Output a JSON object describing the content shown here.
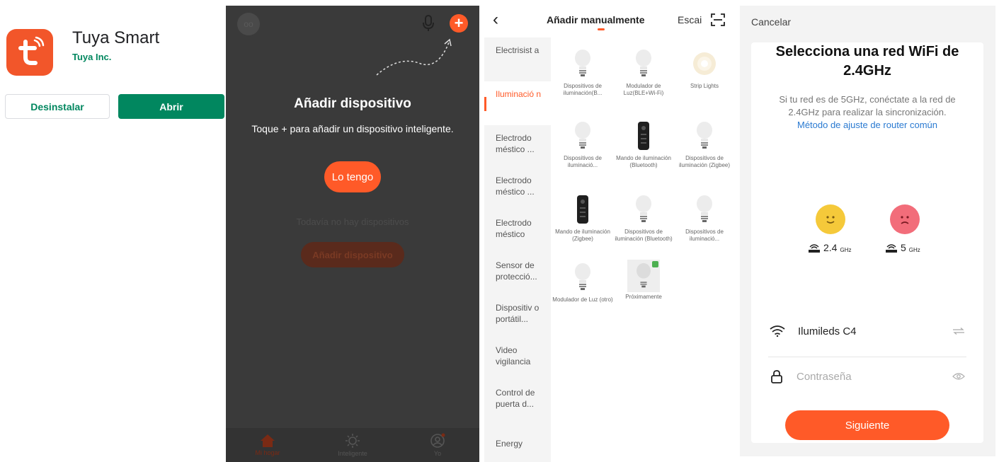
{
  "store": {
    "app_name": "Tuya Smart",
    "developer": "Tuya Inc.",
    "uninstall_label": "Desinstalar",
    "open_label": "Abrir",
    "icon_color": "#f2562a",
    "accent": "#01875f"
  },
  "home": {
    "overlay_title": "Añadir dispositivo",
    "overlay_hint": "Toque + para añadir un dispositivo inteligente.",
    "got_it_label": "Lo tengo",
    "empty_text": "Todavía no hay dispositivos",
    "add_device_label": "Añadir dispositivo",
    "tabs": [
      {
        "label": "Mi hogar",
        "icon": "home-icon"
      },
      {
        "label": "Inteligente",
        "icon": "sun-icon"
      },
      {
        "label": "Yo",
        "icon": "profile-icon"
      }
    ],
    "accent": "#ff5a28"
  },
  "manual": {
    "title": "Añadir manualmente",
    "scan_label": "Escai",
    "categories": [
      "Electrisist a",
      "Iluminació n",
      "Electrodo méstico ...",
      "Electrodo méstico ...",
      "Electrodo méstico",
      "Sensor de protecció...",
      "Dispositiv o portátil...",
      "Video vigilancia",
      "Control de puerta d...",
      "Energy"
    ],
    "active_category": 1,
    "devices": [
      {
        "name": "Dispositivos de iluminación(B...",
        "icon": "bulb-icon"
      },
      {
        "name": "Modulador de Luz(BLE+Wi-Fi)",
        "icon": "bulb-icon"
      },
      {
        "name": "Strip Lights",
        "icon": "strip-light-icon"
      },
      {
        "name": "Dispositivos de iluminació...",
        "icon": "bulb-icon"
      },
      {
        "name": "Mando de iluminación (Bluetooth)",
        "icon": "remote-icon"
      },
      {
        "name": "Dispositivos de iluminación (Zigbee)",
        "icon": "bulb-icon"
      },
      {
        "name": "Mando de iluminación (Zigbee)",
        "icon": "remote-icon"
      },
      {
        "name": "Dispositivos de iluminación (Bluetooth)",
        "icon": "bulb-icon"
      },
      {
        "name": "Dispositivos de iluminació...",
        "icon": "bulb-icon"
      },
      {
        "name": "Modulador de Luz (otro)",
        "icon": "bulb-icon"
      },
      {
        "name": "Próximamente",
        "icon": "bulb-icon"
      }
    ]
  },
  "wifi": {
    "cancel_label": "Cancelar",
    "title": "Selecciona una red WiFi de 2.4GHz",
    "desc": "Si tu red es de 5GHz, conéctate a la red de 2.4GHz para realizar la sincronización.",
    "link": "Método de ajuste de router común",
    "band_ok": "2.4",
    "band_ok_unit": "GHz",
    "band_bad": "5",
    "band_bad_unit": "GHz",
    "network_name": "Ilumileds C4",
    "password_placeholder": "Contraseña",
    "next_label": "Siguiente"
  }
}
